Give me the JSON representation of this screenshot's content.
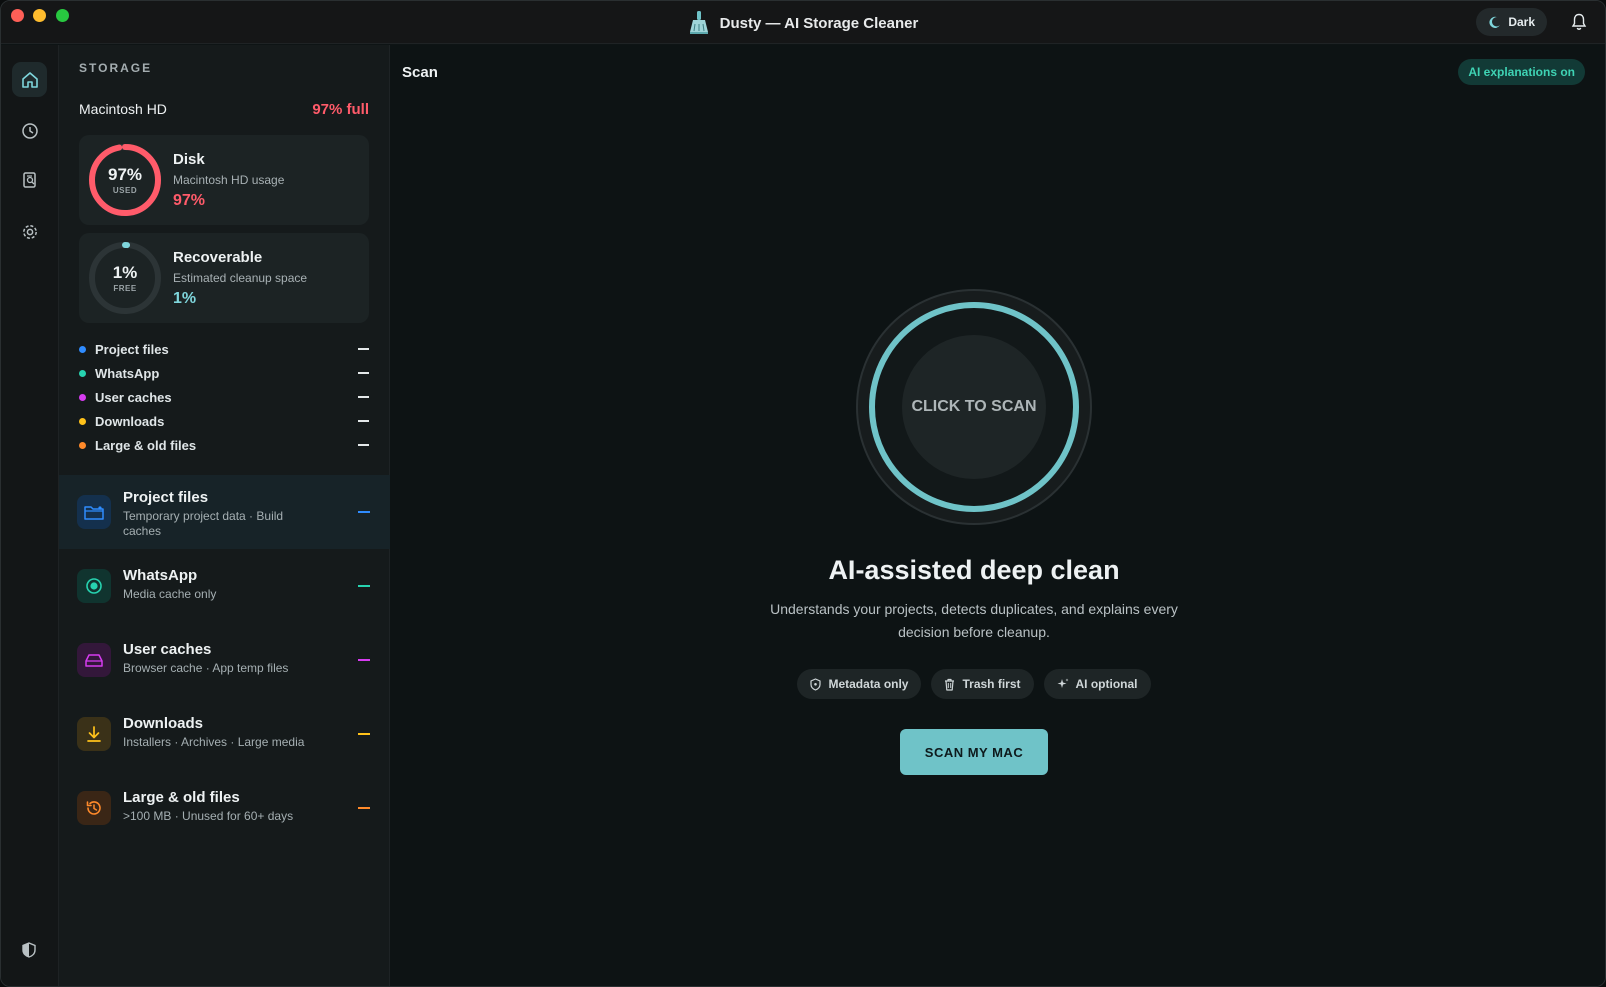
{
  "window": {
    "title": "Dusty — AI Storage Cleaner"
  },
  "titlebar": {
    "theme_label": "Dark"
  },
  "rail": {
    "icons": [
      "home-icon",
      "clock-icon",
      "report-icon",
      "gear-icon"
    ],
    "bottom_icon": "shield-icon"
  },
  "sidebar": {
    "section_label": "STORAGE",
    "drive": {
      "name": "Macintosh HD",
      "status": "97% full"
    },
    "disk_card": {
      "ring_value": "97%",
      "ring_caption": "USED",
      "title": "Disk",
      "subtitle": "Macintosh HD usage",
      "value": "97%",
      "fraction": 0.97,
      "color": "#ff5b6a"
    },
    "recover_card": {
      "ring_value": "1%",
      "ring_caption": "FREE",
      "title": "Recoverable",
      "subtitle": "Estimated cleanup space",
      "value": "1%",
      "fraction": 0.01,
      "color": "#7fd6dc"
    },
    "legend": [
      {
        "label": "Project files",
        "color": "#2f8cff"
      },
      {
        "label": "WhatsApp",
        "color": "#27d3b0"
      },
      {
        "label": "User caches",
        "color": "#d63cf0"
      },
      {
        "label": "Downloads",
        "color": "#ffc21a"
      },
      {
        "label": "Large & old files",
        "color": "#ff8a2a"
      }
    ],
    "categories": [
      {
        "title": "Project files",
        "subtitle": "Temporary project data · Build caches",
        "icon": "folder-icon",
        "color": "#2f8cff"
      },
      {
        "title": "WhatsApp",
        "subtitle": "Media cache only",
        "icon": "whatsapp-icon",
        "color": "#27d3b0"
      },
      {
        "title": "User caches",
        "subtitle": "Browser cache · App temp files",
        "icon": "drive-icon",
        "color": "#d63cf0"
      },
      {
        "title": "Downloads",
        "subtitle": "Installers · Archives · Large media",
        "icon": "download-icon",
        "color": "#ffc21a"
      },
      {
        "title": "Large & old files",
        "subtitle": ">100 MB · Unused for 60+ days",
        "icon": "history-icon",
        "color": "#ff8a2a"
      }
    ]
  },
  "main": {
    "title": "Scan",
    "ai_badge": "AI explanations on",
    "scan_circle_text": "CLICK TO SCAN",
    "headline": "AI-assisted deep clean",
    "description": "Understands your projects, detects duplicates, and explains every decision before cleanup.",
    "chips": [
      {
        "label": "Metadata only",
        "icon": "shield-icon"
      },
      {
        "label": "Trash first",
        "icon": "trash-icon"
      },
      {
        "label": "AI optional",
        "icon": "sparkle-icon"
      }
    ],
    "scan_button": "SCAN MY MAC",
    "accent": "#6fc3c8"
  }
}
